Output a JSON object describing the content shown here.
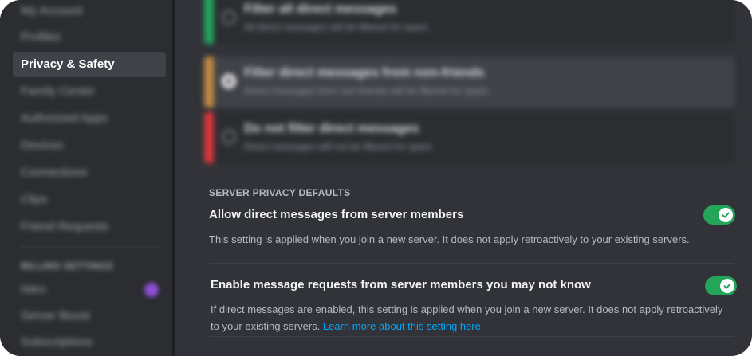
{
  "sidebar": {
    "items": [
      {
        "label": "My Account",
        "state": "blurred"
      },
      {
        "label": "Profiles",
        "state": "blurred"
      },
      {
        "label": "Privacy & Safety",
        "state": "active"
      },
      {
        "label": "Family Center",
        "state": "blurred"
      },
      {
        "label": "Authorized Apps",
        "state": "blurred"
      },
      {
        "label": "Devices",
        "state": "blurred"
      },
      {
        "label": "Connections",
        "state": "blurred"
      },
      {
        "label": "Clips",
        "state": "blurred"
      },
      {
        "label": "Friend Requests",
        "state": "blurred"
      }
    ],
    "billing_heading": "Billing Settings",
    "billing_items": [
      {
        "label": "Nitro",
        "state": "blurred"
      },
      {
        "label": "Server Boost",
        "state": "blurred"
      },
      {
        "label": "Subscriptions",
        "state": "blurred"
      }
    ]
  },
  "dm_filter": {
    "options": [
      {
        "title": "Filter all direct messages",
        "desc": "All direct messages will be filtered for spam.",
        "color": "#23a55a",
        "selected": false
      },
      {
        "title": "Filter direct messages from non-friends",
        "desc": "Direct messages from non-friends will be filtered for spam.",
        "color": "#c28a43",
        "selected": true
      },
      {
        "title": "Do not filter direct messages",
        "desc": "Direct messages will not be filtered for spam.",
        "color": "#da373c",
        "selected": false
      }
    ]
  },
  "server_privacy": {
    "heading": "SERVER PRIVACY DEFAULTS",
    "allow_dm": {
      "title": "Allow direct messages from server members",
      "desc": "This setting is applied when you join a new server. It does not apply retroactively to your existing servers.",
      "enabled": true
    },
    "message_requests": {
      "title": "Enable message requests from server members you may not know",
      "desc_line1": "If direct messages are enabled, this setting is applied when you join a new server. It does not apply retroactively",
      "desc_line2": "to your existing servers.",
      "link": "Learn more about this setting here.",
      "enabled": true
    }
  },
  "colors": {
    "accent_green": "#23a55a",
    "link_blue": "#00a8fc",
    "background": "#313338",
    "sidebar": "#2b2d31"
  }
}
